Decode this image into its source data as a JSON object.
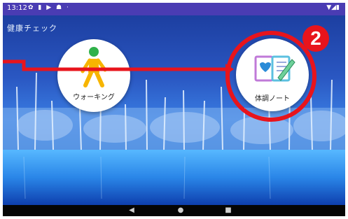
{
  "statusbar": {
    "time": "13:12",
    "left_icons": [
      "settings-icon",
      "notification-icon",
      "media-icon",
      "android-icon",
      "dot-icon"
    ],
    "right_icons": [
      "wifi-icon",
      "signal-icon",
      "battery-icon"
    ]
  },
  "app": {
    "title": "健康チェック"
  },
  "tiles": [
    {
      "label": "ウォーキング",
      "icon": "walking-person-icon"
    },
    {
      "label": "体調ノート",
      "icon": "health-notebook-icon"
    }
  ],
  "annotation": {
    "badge_number": "2",
    "color": "#e8141c"
  },
  "navbar": {
    "buttons": [
      "back-icon",
      "home-icon",
      "recents-icon"
    ]
  },
  "colors": {
    "statusbar": "#4a3cb3",
    "accent_red": "#e8141c",
    "navbar": "#050505"
  }
}
